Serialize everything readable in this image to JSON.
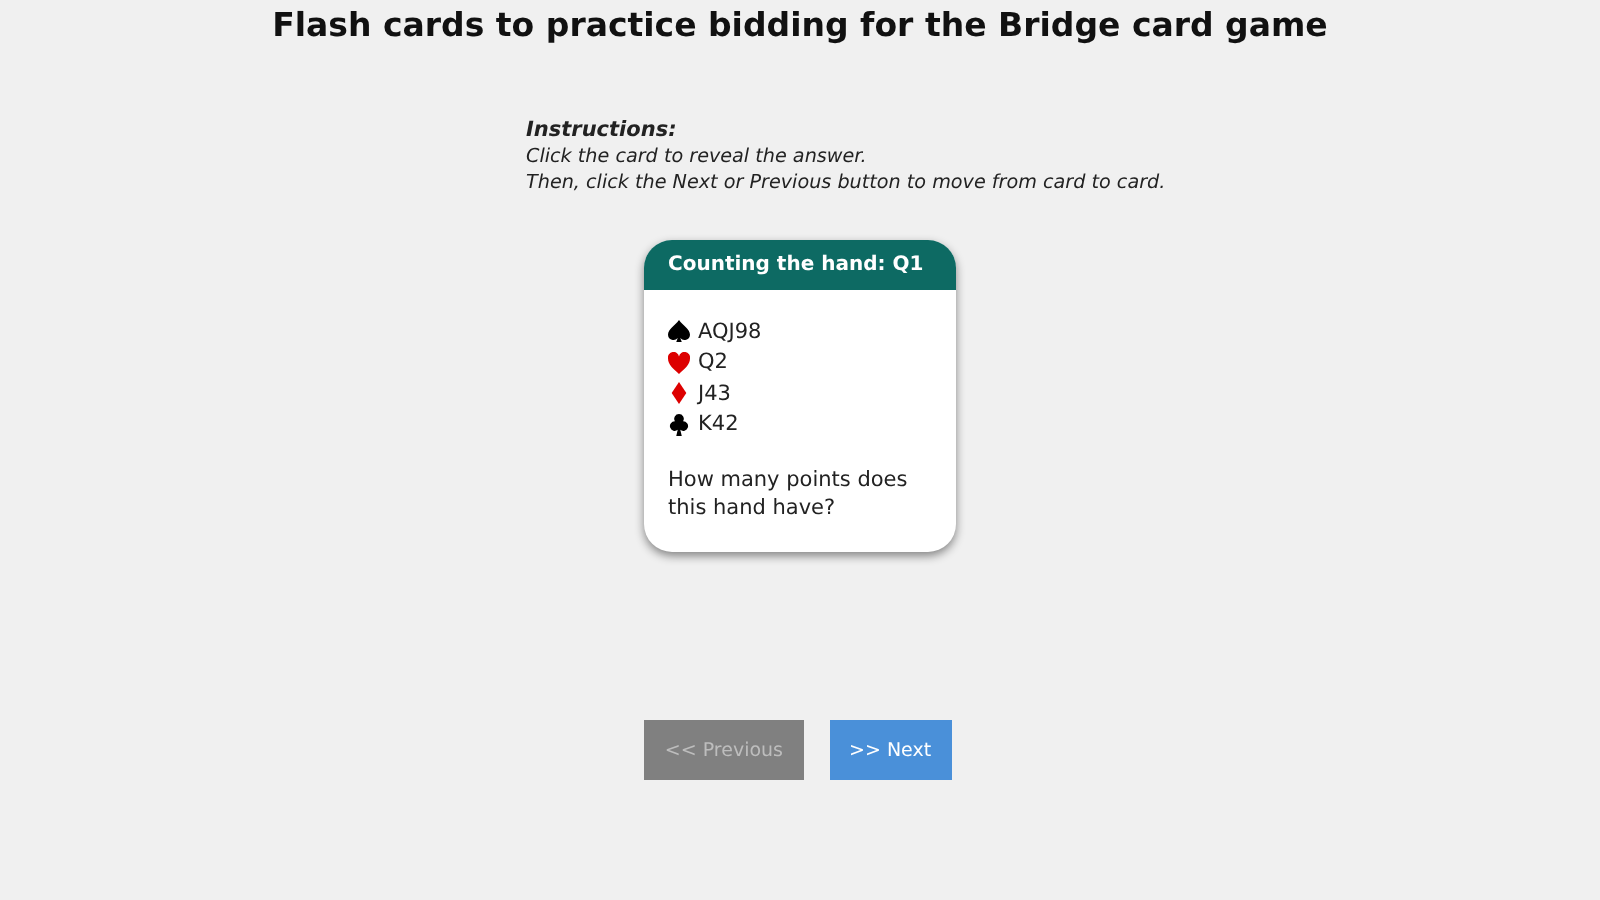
{
  "title": "Flash cards to practice bidding for the Bridge card game",
  "instructions": {
    "heading": "Instructions:",
    "lines": [
      "Click the card to reveal the answer.",
      "Then, click the Next or Previous button to move from card to card."
    ]
  },
  "card": {
    "header": "Counting the hand: Q1",
    "hand": [
      {
        "kind": "spades",
        "cards": "AQJ98"
      },
      {
        "kind": "hearts",
        "cards": "Q2"
      },
      {
        "kind": "diamonds",
        "cards": "J43"
      },
      {
        "kind": "clubs",
        "cards": "K42"
      }
    ],
    "question": "How many points does this hand have?"
  },
  "buttons": [
    {
      "label": "<< Previous",
      "disabled": true
    },
    {
      "label": ">> Next",
      "disabled": false
    }
  ]
}
